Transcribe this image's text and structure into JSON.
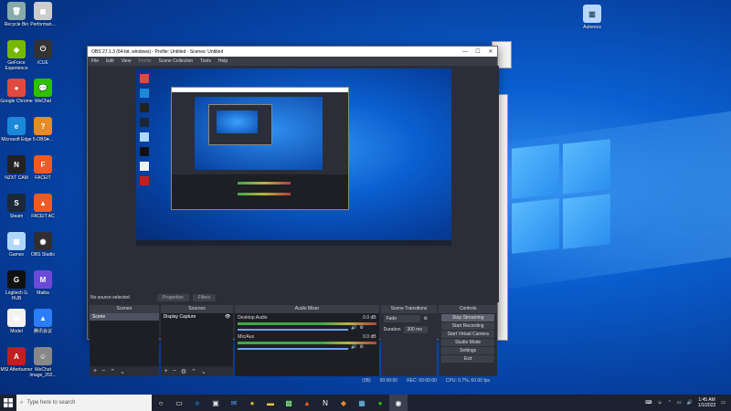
{
  "desktop": {
    "icons": [
      {
        "label": "Recycle Bin",
        "glyph": "🗑",
        "color": "#8aa"
      },
      {
        "label": "Performan...",
        "glyph": "◼",
        "color": "#ccc"
      },
      {
        "label": "GeForce Experience",
        "glyph": "◆",
        "color": "#76b900"
      },
      {
        "label": "iCUE",
        "glyph": "⏻",
        "color": "#333"
      },
      {
        "label": "Google Chrome",
        "glyph": "●",
        "color": "#e04a3f"
      },
      {
        "label": "WeChat",
        "glyph": "💬",
        "color": "#2dc100"
      },
      {
        "label": "Microsoft Edge",
        "glyph": "e",
        "color": "#1c88d8"
      },
      {
        "label": "5-OBS♥...",
        "glyph": "?",
        "color": "#e88b25"
      },
      {
        "label": "NZXT CAM",
        "glyph": "N",
        "color": "#222"
      },
      {
        "label": "FACEIT",
        "glyph": "F",
        "color": "#f05a23"
      },
      {
        "label": "Steam",
        "glyph": "S",
        "color": "#1b2838"
      },
      {
        "label": "FACEIT AC",
        "glyph": "▲",
        "color": "#f05a23"
      },
      {
        "label": "Games",
        "glyph": "▦",
        "color": "#b0d8ff"
      },
      {
        "label": "OBS Studio",
        "glyph": "◉",
        "color": "#302e31"
      },
      {
        "label": "Logitech G HUB",
        "glyph": "G",
        "color": "#111"
      },
      {
        "label": "Maiba",
        "glyph": "M",
        "color": "#6b4ad8"
      },
      {
        "label": "Model",
        "glyph": "▤",
        "color": "#f2f2f2"
      },
      {
        "label": "腾讯会议",
        "glyph": "▲",
        "color": "#2b7cf7"
      },
      {
        "label": "MSI Afterburner",
        "glyph": "A",
        "color": "#c02020"
      },
      {
        "label": "WeChat Image_202...",
        "glyph": "☺",
        "color": "#888"
      }
    ],
    "right_icon": {
      "label": "Autorecs",
      "glyph": "▥",
      "color": "#b8d8ff"
    }
  },
  "obs": {
    "title": "OBS 27.1.3 (64-bit, windows) - Profile: Untitled - Scenes: Untitled",
    "controls": {
      "minimize": "—",
      "maximize": "☐",
      "close": "✕"
    },
    "menu": [
      "File",
      "Edit",
      "View",
      "Profile",
      "Scene Collection",
      "Tools",
      "Help"
    ],
    "status_left": "No source selected",
    "properties_btn": "Properties",
    "filters_btn": "Filters",
    "docks": {
      "scenes": {
        "title": "Scenes",
        "items": [
          "Scene"
        ]
      },
      "sources": {
        "title": "Sources",
        "items": [
          "Display Capture"
        ]
      },
      "mixer": {
        "title": "Audio Mixer",
        "channels": [
          {
            "name": "Desktop Audio",
            "db": "0.0 dB",
            "level": 0.7
          },
          {
            "name": "Mic/Aux",
            "db": "0.0 dB",
            "level": 0.6
          }
        ]
      },
      "transitions": {
        "title": "Scene Transitions",
        "type": "Fade",
        "duration_label": "Duration",
        "duration": "300 ms"
      },
      "controls": {
        "title": "Controls",
        "buttons": [
          "Stop Streaming",
          "Start Recording",
          "Start Virtual Camera",
          "Studio Mode",
          "Settings",
          "Exit"
        ]
      }
    },
    "footer": {
      "dropped": "(0B)",
      "live": "00:00:00",
      "rec": "REC: 00:00:00",
      "cpu": "CPU: 0.7%, 60.00 fps"
    }
  },
  "taskbar": {
    "search_placeholder": "Type here to search",
    "time": "1:45 AM",
    "date": "1/1/2022"
  }
}
